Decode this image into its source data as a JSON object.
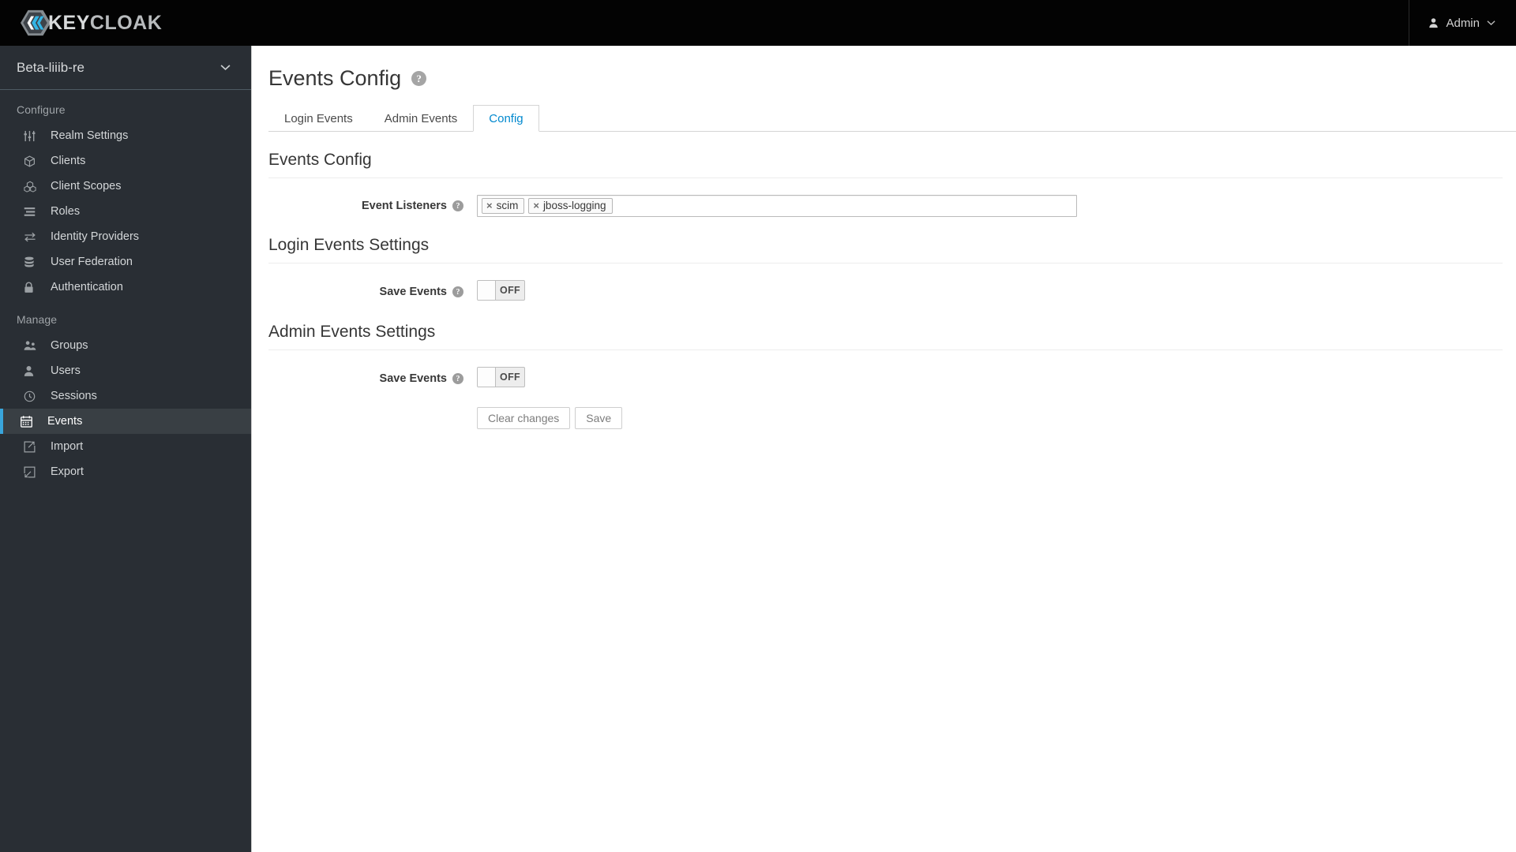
{
  "masthead": {
    "brand_dark": "KEY",
    "brand_light": "CLOAK",
    "user_label": "Admin"
  },
  "sidebar": {
    "realm": "Beta-liiib-re",
    "groups": [
      {
        "title": "Configure",
        "items": [
          {
            "label": "Realm Settings",
            "icon": "sliders-icon",
            "active": false
          },
          {
            "label": "Clients",
            "icon": "cube-icon",
            "active": false
          },
          {
            "label": "Client Scopes",
            "icon": "cubes-icon",
            "active": false
          },
          {
            "label": "Roles",
            "icon": "list-icon",
            "active": false
          },
          {
            "label": "Identity Providers",
            "icon": "exchange-arrows-icon",
            "active": false
          },
          {
            "label": "User Federation",
            "icon": "database-icon",
            "active": false
          },
          {
            "label": "Authentication",
            "icon": "lock-icon",
            "active": false
          }
        ]
      },
      {
        "title": "Manage",
        "items": [
          {
            "label": "Groups",
            "icon": "users-group-icon",
            "active": false
          },
          {
            "label": "Users",
            "icon": "user-icon",
            "active": false
          },
          {
            "label": "Sessions",
            "icon": "clock-icon",
            "active": false
          },
          {
            "label": "Events",
            "icon": "calendar-icon",
            "active": true
          },
          {
            "label": "Import",
            "icon": "import-arrow-icon",
            "active": false
          },
          {
            "label": "Export",
            "icon": "export-arrow-icon",
            "active": false
          }
        ]
      }
    ]
  },
  "main": {
    "page_title": "Events Config",
    "page_help": "?",
    "tabs": [
      {
        "label": "Login Events",
        "active": false
      },
      {
        "label": "Admin Events",
        "active": false
      },
      {
        "label": "Config",
        "active": true
      }
    ],
    "sections": [
      {
        "title": "Events Config",
        "field_label": "Event Listeners",
        "field_help": "?",
        "chips": [
          {
            "label": "scim",
            "remove": "×"
          },
          {
            "label": "jboss-logging",
            "remove": "×"
          }
        ]
      },
      {
        "title": "Login Events Settings",
        "field_label": "Save Events",
        "field_help": "?",
        "toggle_state": "OFF"
      },
      {
        "title": "Admin Events Settings",
        "field_label": "Save Events",
        "field_help": "?",
        "toggle_state": "OFF"
      }
    ],
    "buttons": {
      "clear": "Clear changes",
      "save": "Save"
    }
  },
  "colors": {
    "accent_blue": "#0088ce",
    "active_marker": "#39a5dc",
    "sidebar_bg": "#292e34",
    "masthead_bg": "#030303"
  }
}
